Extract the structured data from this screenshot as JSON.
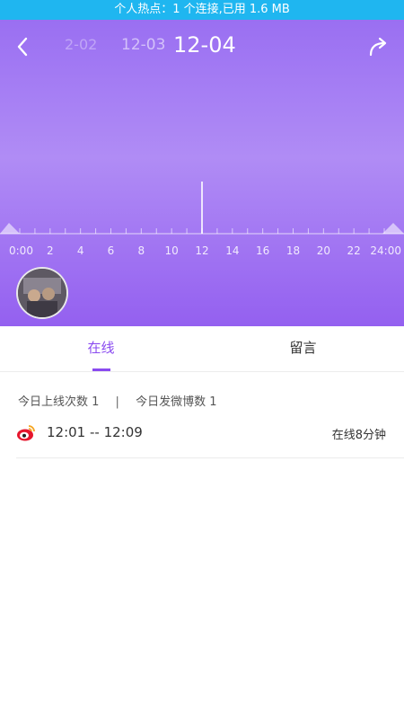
{
  "status_bar": {
    "text": "个人热点：1 个连接,已用 1.6 MB"
  },
  "header": {
    "dates": [
      "2-02",
      "12-03",
      "12-04"
    ],
    "back_icon": "chevron-left-icon",
    "share_icon": "share-arrow-icon"
  },
  "timeline": {
    "labels": [
      "0:00",
      "2",
      "4",
      "6",
      "8",
      "10",
      "12",
      "14",
      "16",
      "18",
      "20",
      "22",
      "24:00"
    ],
    "marker_hour": 12
  },
  "tabs": [
    {
      "label": "在线",
      "active": true
    },
    {
      "label": "留言",
      "active": false
    }
  ],
  "summary": {
    "online_count_label": "今日上线次数 1",
    "separator": "|",
    "weibo_count_label": "今日发微博数 1"
  },
  "sessions": [
    {
      "icon": "weibo-icon",
      "time_range": "12:01 -- 12:09",
      "duration": "在线8分钟"
    }
  ],
  "colors": {
    "accent": "#8a4bf0",
    "status_bar": "#1fb6f0",
    "hero_top": "#9a6ff2",
    "hero_bottom": "#9460f0"
  }
}
